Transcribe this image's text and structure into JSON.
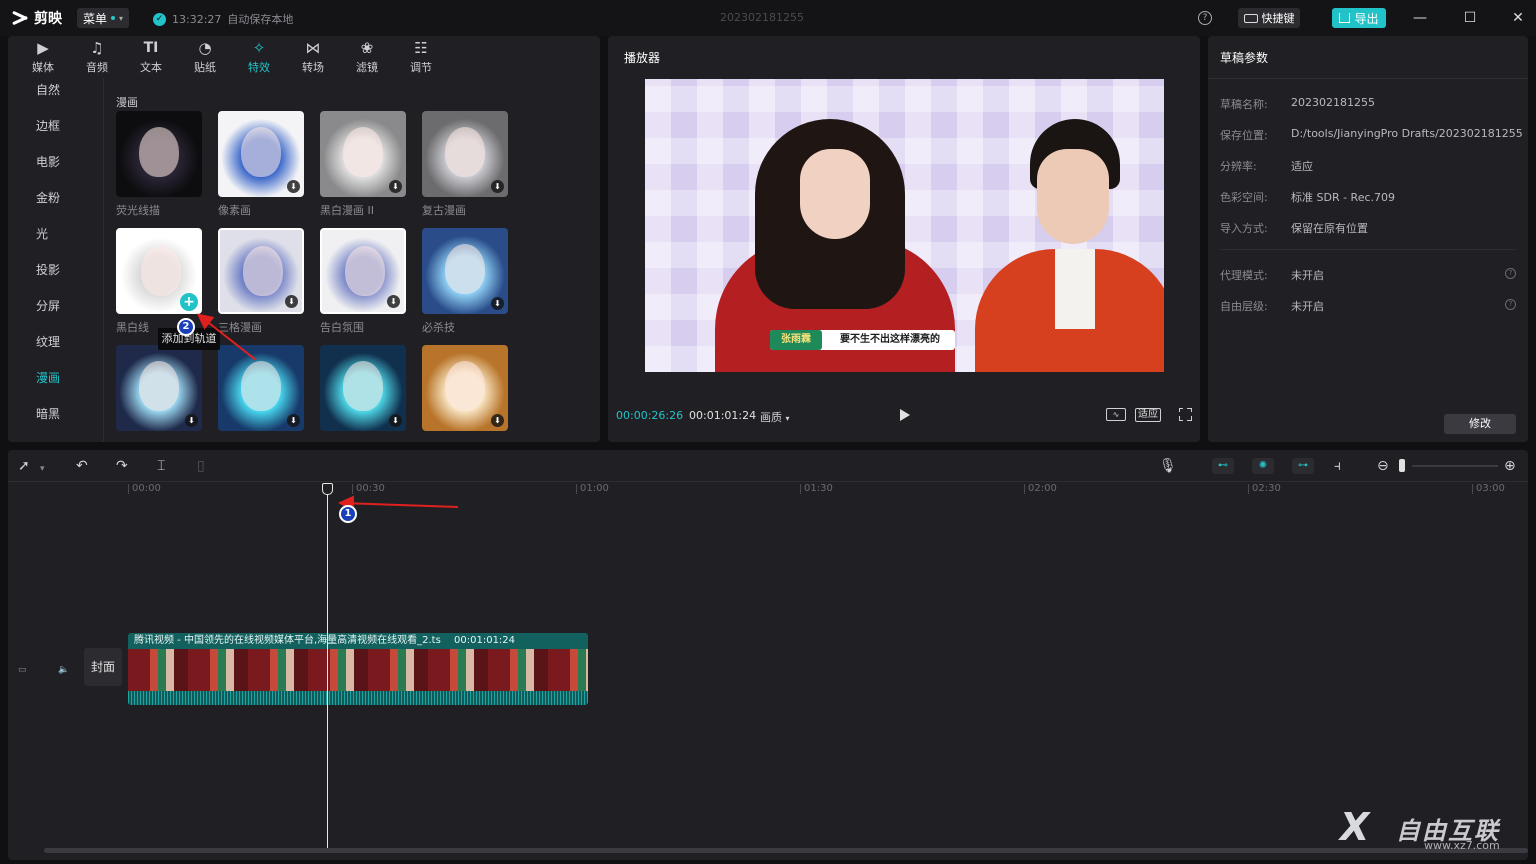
{
  "titlebar": {
    "app_name": "剪映",
    "menu_label": "菜单",
    "save_time": "13:32:27",
    "save_text": "自动保存本地",
    "doc_title": "202302181255",
    "shortcut_label": "快捷键",
    "export_label": "导出"
  },
  "media": {
    "tabs": [
      {
        "label": "媒体",
        "icon": "media-icon"
      },
      {
        "label": "音频",
        "icon": "audio-icon"
      },
      {
        "label": "文本",
        "icon": "text-icon"
      },
      {
        "label": "贴纸",
        "icon": "sticker-icon"
      },
      {
        "label": "特效",
        "icon": "effects-icon",
        "active": true
      },
      {
        "label": "转场",
        "icon": "transition-icon"
      },
      {
        "label": "滤镜",
        "icon": "filter-icon"
      },
      {
        "label": "调节",
        "icon": "adjust-icon"
      }
    ],
    "categories": [
      "自然",
      "边框",
      "电影",
      "金粉",
      "光",
      "投影",
      "分屏",
      "纹理",
      "漫画",
      "暗黑"
    ],
    "active_category": "漫画",
    "section_title": "漫画",
    "effects": [
      {
        "label": "荧光线描"
      },
      {
        "label": "像素画"
      },
      {
        "label": "黑白漫画 II"
      },
      {
        "label": "复古漫画"
      },
      {
        "label": "黑白线"
      },
      {
        "label": "三格漫画"
      },
      {
        "label": "告白氛围"
      },
      {
        "label": "必杀技"
      },
      {
        "label": ""
      },
      {
        "label": ""
      },
      {
        "label": ""
      },
      {
        "label": ""
      }
    ],
    "tooltip": "添加到轨道"
  },
  "player": {
    "title": "播放器",
    "caption_name": "张雨霖",
    "caption_text": "要不生不出这样漂亮的",
    "current_time": "00:00:26:26",
    "total_time": "00:01:01:24",
    "quality_label": "画质",
    "fit_label": "适应"
  },
  "params": {
    "title": "草稿参数",
    "rows": [
      {
        "key": "草稿名称:",
        "value": "202302181255"
      },
      {
        "key": "保存位置:",
        "value": "D:/tools/JianyingPro Drafts/202302181255"
      },
      {
        "key": "分辨率:",
        "value": "适应"
      },
      {
        "key": "色彩空间:",
        "value": "标准 SDR - Rec.709"
      },
      {
        "key": "导入方式:",
        "value": "保留在原有位置"
      }
    ],
    "rows2": [
      {
        "key": "代理模式:",
        "value": "未开启"
      },
      {
        "key": "自由层级:",
        "value": "未开启"
      }
    ],
    "modify_label": "修改"
  },
  "timeline": {
    "ticks": [
      "00:00",
      "00:30",
      "01:00",
      "01:30",
      "02:00",
      "02:30",
      "03:00"
    ],
    "cover_label": "封面",
    "clip_name": "腾讯视频 - 中国领先的在线视频媒体平台,海量高清视频在线观看_2.ts",
    "clip_duration": "00:01:01:24"
  },
  "annotations": {
    "step1": "1",
    "step2": "2"
  },
  "watermark": {
    "brand": "自由互联",
    "url": "www.xz7.com"
  },
  "colors": {
    "accent": "#22c3c8",
    "annotation_arrow": "#e0201f",
    "annotation_badge": "#1a3fb8"
  }
}
